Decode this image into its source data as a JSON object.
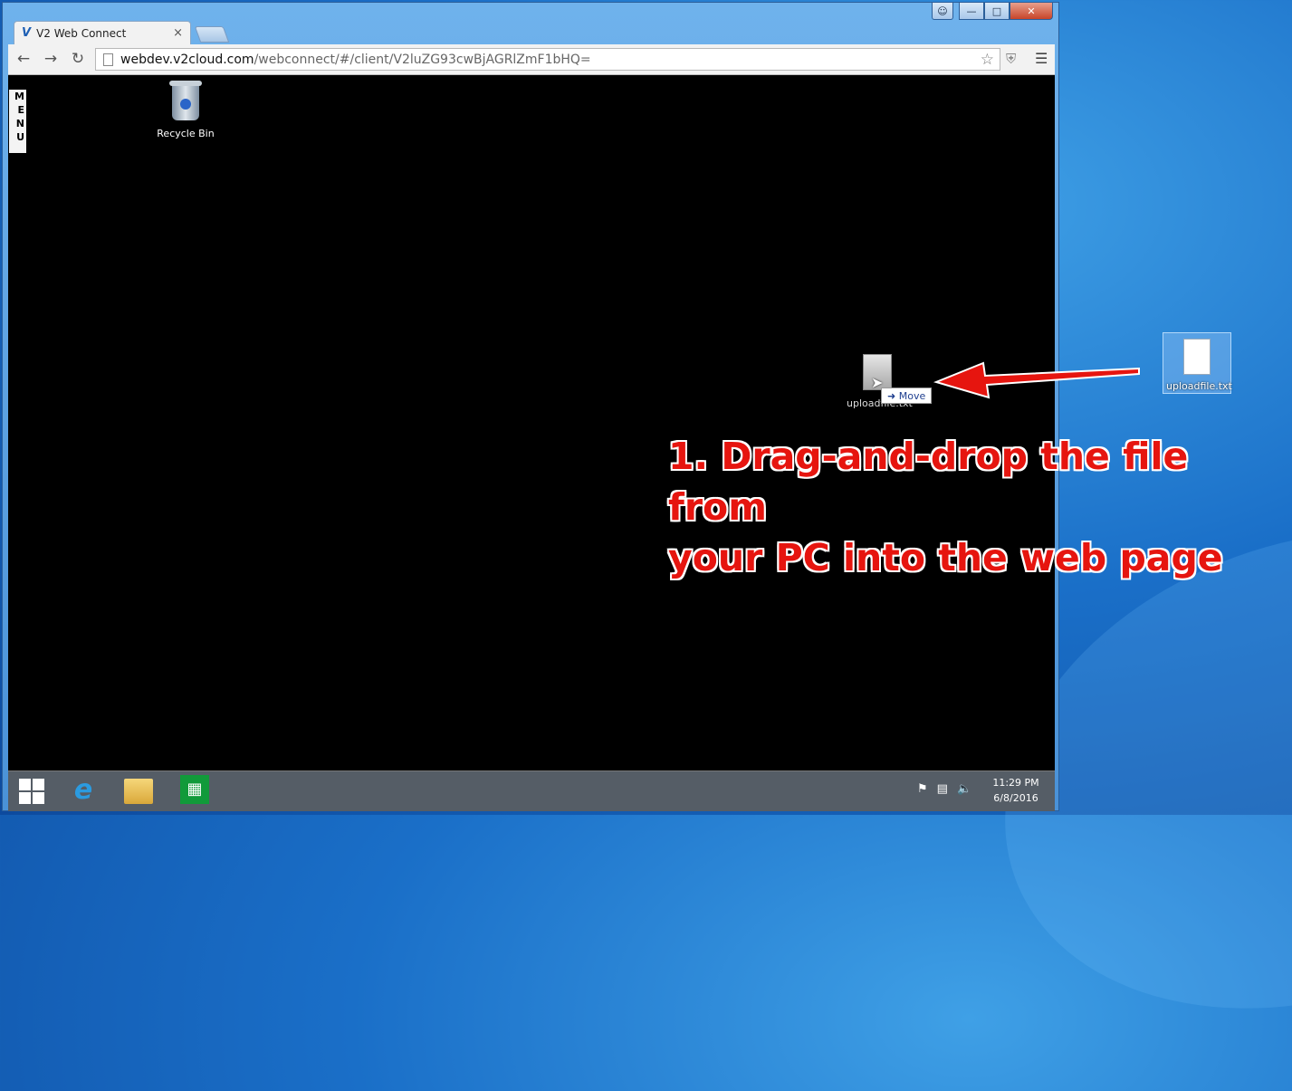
{
  "browser": {
    "tab_title": "V2 Web Connect",
    "tab_close": "×",
    "url_host": "webdev.v2cloud.com",
    "url_path": "/webconnect/#/client/V2luZG93cwBjAGRlZmF1bHQ=",
    "window_controls": {
      "minimize": "—",
      "maximize": "□",
      "close": "✕"
    }
  },
  "remote_desktop": {
    "menu_letters": [
      "M",
      "E",
      "N",
      "U"
    ],
    "recycle_bin_label": "Recycle Bin",
    "dragged_file_label": "uploadfile.txt",
    "drag_tooltip": "Move",
    "taskbar": {
      "time": "11:29 PM",
      "date": "6/8/2016"
    }
  },
  "host_desktop": {
    "file_label": "uploadfile.txt"
  },
  "annotation": {
    "line1": "1. Drag-and-drop the file from",
    "line2": "your PC into the web page",
    "color": "#e6150f"
  },
  "icons": [
    "back-icon",
    "forward-icon",
    "reload-icon",
    "star-icon",
    "shield-icon",
    "menu-icon",
    "recycle-bin-icon",
    "windows-start-icon",
    "internet-explorer-icon",
    "file-explorer-icon",
    "store-icon"
  ]
}
